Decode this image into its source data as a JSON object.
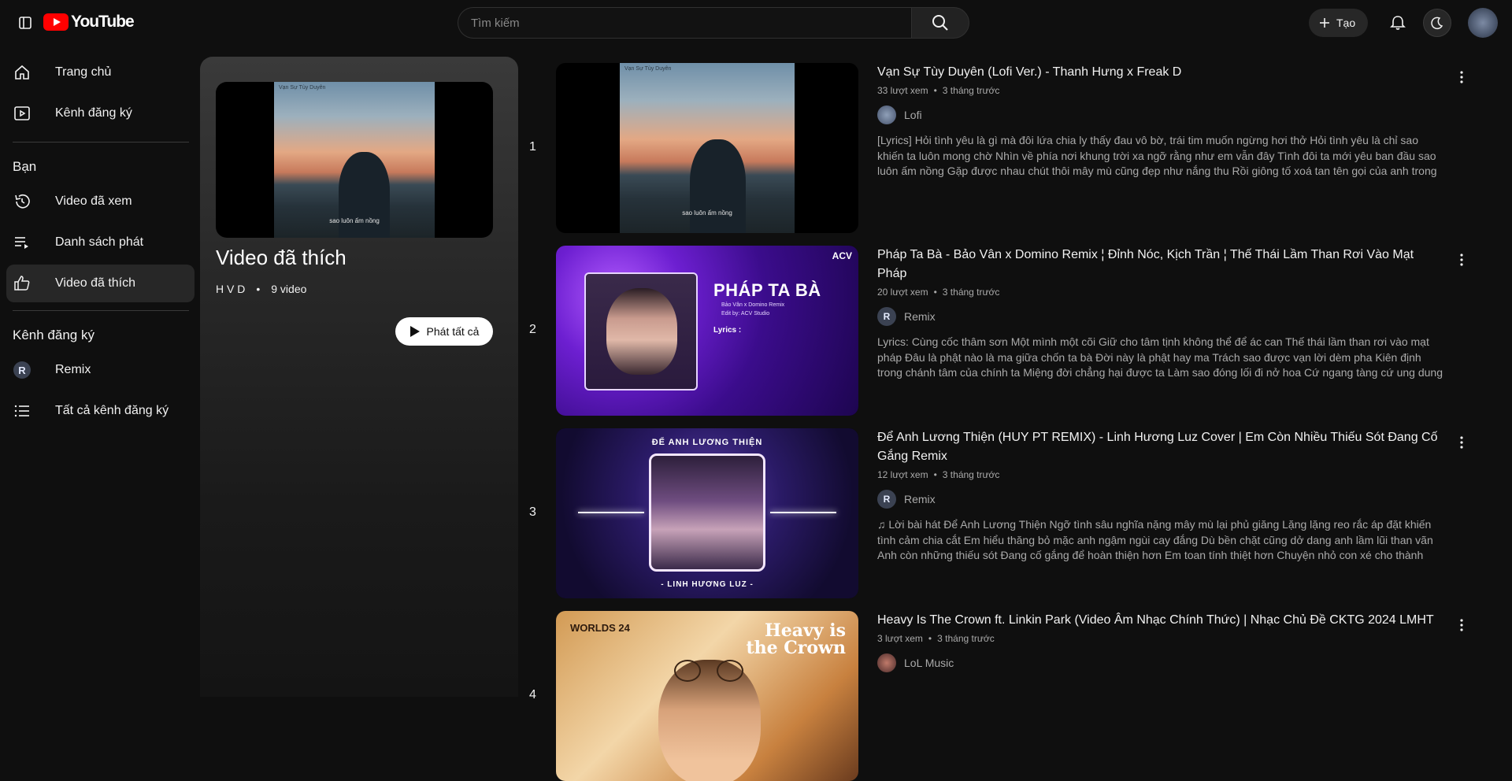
{
  "header": {
    "logo_text": "YouTube",
    "search_placeholder": "Tìm kiếm",
    "create_label": "Tạo"
  },
  "sidebar": {
    "home": "Trang chủ",
    "subscriptions": "Kênh đăng ký",
    "you_title": "Bạn",
    "history": "Video đã xem",
    "playlists": "Danh sách phát",
    "liked": "Video đã thích",
    "subs_title": "Kênh đăng ký",
    "sub_channel": "Remix",
    "all_subs": "Tất cả kênh đăng ký"
  },
  "playlist": {
    "title": "Video đã thích",
    "owner": "H V D",
    "count": "9 video",
    "play_all": "Phát tất cả",
    "thumb_caption_top": "Vạn Sự Tùy Duyên",
    "thumb_caption_bottom": "sao luôn ấm nồng"
  },
  "videos": [
    {
      "index": "1",
      "title": "Vạn Sự Tùy Duyên (Lofi Ver.) - Thanh Hưng x Freak D",
      "views": "33 lượt xem",
      "age": "3 tháng trước",
      "channel": "Lofi",
      "description": "[Lyrics] Hỏi tình yêu là gì mà đôi lứa chia ly thấy đau vô bờ, trái tim muốn ngừng hơi thở Hỏi tình yêu là chỉ sao khiến ta luôn mong chờ Nhìn về phía nơi khung trời xa ngỡ rằng như em vẫn đây Tình đôi ta mới yêu ban đầu sao luôn ấm nồng Gặp được nhau chút thôi mây mù cũng đẹp như nắng thu Rồi giông tố xoá tan tên gọi của anh trong trái tim...",
      "thumb_caption_top": "Vạn Sự Tùy Duyên",
      "thumb_caption_bottom": "sao luôn ấm nồng"
    },
    {
      "index": "2",
      "title": "Pháp Ta Bà - Bảo Vân x Domino Remix ¦ Đỉnh Nóc, Kịch Trần ¦ Thế Thái Lầm Than Rơi Vào Mạt Pháp",
      "views": "20 lượt xem",
      "age": "3 tháng trước",
      "channel": "Remix",
      "description": "Lyrics: Cùng cốc thâm sơn Một mình một cõi Giữ cho tâm tịnh không thể để ác can Thế thái lầm than rơi vào mạt pháp Đâu là phật nào là ma giữa chốn ta bà Đời này là phật hay ma Trách sao được vạn lời dèm pha Kiên định trong chánh tâm của chính ta Miệng đời chẳng hại được ta Làm sao đóng lối đi nở hoa Cứ ngang tàng cứ ung dung cứ t...",
      "thumb_title": "PHÁP TA BÀ",
      "thumb_sub1": "Bảo Vân x Domino Remix",
      "thumb_sub2": "Edit by: ACV Studio",
      "thumb_lyrics": "Lyrics :",
      "thumb_brand": "ACV"
    },
    {
      "index": "3",
      "title": "Để Anh Lương Thiện (HUY PT REMIX) - Linh Hương Luz Cover | Em Còn Nhiều Thiếu Sót Đang Cố Gắng Remix",
      "views": "12 lượt xem",
      "age": "3 tháng trước",
      "channel": "Remix",
      "description": "♫ Lời bài hát Để Anh Lương Thiện Ngỡ tình sâu nghĩa nặng mây mù lại phủ giăng Lặng lặng reo rắc áp đặt khiến tình cảm chia cắt Em hiểu thăng bỏ mặc anh ngậm ngùi cay đắng Dù bền chặt cũng dở dang anh lầm lũi than vãn Anh còn những thiếu sót Đang cố gắng để hoàn thiện hơn Em toan tính thiệt hơn Chuyện nhỏ con xé cho thành lớ...",
      "thumb_top": "ĐỂ ANH LƯƠNG THIỆN",
      "thumb_bottom": "- LINH HƯƠNG LUZ -"
    },
    {
      "index": "4",
      "title": "Heavy Is The Crown ft. Linkin Park (Video Âm Nhạc Chính Thức) | Nhạc Chủ Đề CKTG 2024 LMHT",
      "views": "3 lượt xem",
      "age": "3 tháng trước",
      "channel": "LoL Music",
      "description": "",
      "thumb_left": "WORLDS 24",
      "thumb_right_1": "Heavy is",
      "thumb_right_2": "the Crown"
    }
  ],
  "colors": {
    "background": "#0f0f0f",
    "brand_red": "#ff0000",
    "active_item": "#272727"
  }
}
